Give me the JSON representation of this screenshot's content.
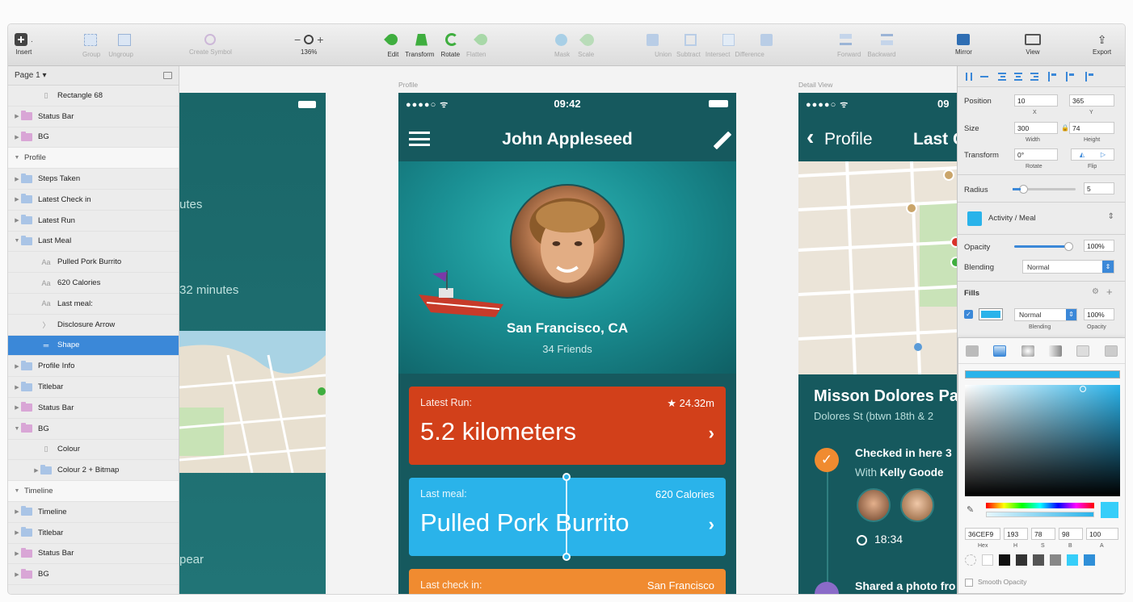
{
  "toolbar": {
    "insert": "Insert",
    "group": "Group",
    "ungroup": "Ungroup",
    "create_symbol": "Create Symbol",
    "zoom": "136%",
    "zoom_minus": "−",
    "zoom_plus": "+",
    "edit": "Edit",
    "transform": "Transform",
    "rotate": "Rotate",
    "flatten": "Flatten",
    "mask": "Mask",
    "scale": "Scale",
    "union": "Union",
    "subtract": "Subtract",
    "intersect": "Intersect",
    "difference": "Difference",
    "forward": "Forward",
    "backward": "Backward",
    "mirror": "Mirror",
    "view": "View",
    "export": "Export"
  },
  "sidebar": {
    "page": "Page 1 ▾",
    "layers": [
      {
        "label": "Rectangle 68",
        "kind": "rect",
        "indent": 1
      },
      {
        "label": "Status Bar",
        "kind": "folder-pink",
        "indent": 0
      },
      {
        "label": "BG",
        "kind": "folder-pink",
        "indent": 0
      },
      {
        "label": "Profile",
        "kind": "section",
        "indent": 0
      },
      {
        "label": "Steps Taken",
        "kind": "folder",
        "indent": 0
      },
      {
        "label": "Latest Check in",
        "kind": "folder",
        "indent": 0
      },
      {
        "label": "Latest Run",
        "kind": "folder",
        "indent": 0
      },
      {
        "label": "Last Meal",
        "kind": "folder-open",
        "indent": 0
      },
      {
        "label": "Pulled Pork Burrito",
        "kind": "text",
        "indent": 1
      },
      {
        "label": "620 Calories",
        "kind": "text",
        "indent": 1
      },
      {
        "label": "Last meal:",
        "kind": "text",
        "indent": 1
      },
      {
        "label": "Disclosure Arrow",
        "kind": "shape-arrow",
        "indent": 1
      },
      {
        "label": "Shape",
        "kind": "shape-selected",
        "indent": 1
      },
      {
        "label": "Profile Info",
        "kind": "folder",
        "indent": 0
      },
      {
        "label": "Titlebar",
        "kind": "folder",
        "indent": 0
      },
      {
        "label": "Status Bar",
        "kind": "folder-pink",
        "indent": 0
      },
      {
        "label": "BG",
        "kind": "folder-pink-open",
        "indent": 0
      },
      {
        "label": "Colour",
        "kind": "rect",
        "indent": 1
      },
      {
        "label": "Colour 2 + Bitmap",
        "kind": "folder",
        "indent": 1
      },
      {
        "label": "Timeline",
        "kind": "section",
        "indent": 0
      },
      {
        "label": "Timeline",
        "kind": "folder",
        "indent": 0
      },
      {
        "label": "Titlebar",
        "kind": "folder",
        "indent": 0
      },
      {
        "label": "Status Bar",
        "kind": "folder-pink",
        "indent": 0
      },
      {
        "label": "BG",
        "kind": "folder-pink",
        "indent": 0
      }
    ]
  },
  "canvas": {
    "artboard_left": {
      "text1": "utes",
      "text2": "32 minutes",
      "text3": "pear"
    },
    "profile": {
      "label": "Profile",
      "signal": "●●●●○ ᯤ",
      "time": "09:42",
      "title": "John Appleseed",
      "city": "San Francisco, CA",
      "friends": "34 Friends",
      "cards": [
        {
          "label": "Latest Run:",
          "right": "★ 24.32m",
          "big": "5.2 kilometers",
          "color": "#d2401a"
        },
        {
          "label": "Last meal:",
          "right": "620 Calories",
          "big": "Pulled Pork Burrito",
          "color": "#2ab3ea"
        },
        {
          "label": "Last check in:",
          "right": "San Francisco",
          "big": "",
          "color": "#f08b30"
        }
      ],
      "chevron": "›"
    },
    "detail": {
      "label": "Detail View",
      "signal": "●●●●○ ᯤ",
      "time": "09",
      "back": "Profile",
      "title": "Last C",
      "place": "Misson Dolores Pa",
      "addr": "Dolores St (btwn 18th & 2",
      "checked": "Checked in here 3",
      "with_prefix": "With ",
      "with_name": "Kelly Goode",
      "time_stamp": "18:34",
      "shared": "Shared a photo fro"
    }
  },
  "inspector": {
    "position_label": "Position",
    "x": "10",
    "y": "365",
    "x_label": "X",
    "y_label": "Y",
    "size_label": "Size",
    "width": "300",
    "height": "74",
    "width_label": "Width",
    "height_label": "Height",
    "transform_label": "Transform",
    "rotate": "0°",
    "rotate_label": "Rotate",
    "flip_label": "Flip",
    "radius_label": "Radius",
    "radius": "5",
    "style": "Activity / Meal",
    "opacity_label": "Opacity",
    "opacity": "100%",
    "blending_label": "Blending",
    "blending": "Normal",
    "fills_label": "Fills",
    "fill_blend": "Normal",
    "fill_opacity": "100%",
    "fill_blend_label": "Blending",
    "fill_opacity_label": "Opacity",
    "hex": "36CEF9",
    "h": "193",
    "s": "78",
    "b": "98",
    "a": "100",
    "hex_label": "Hex",
    "h_label": "H",
    "s_label": "S",
    "b_label": "B",
    "a_label": "A",
    "smooth": "Smooth Opacity",
    "accent": "#36CEF9"
  }
}
